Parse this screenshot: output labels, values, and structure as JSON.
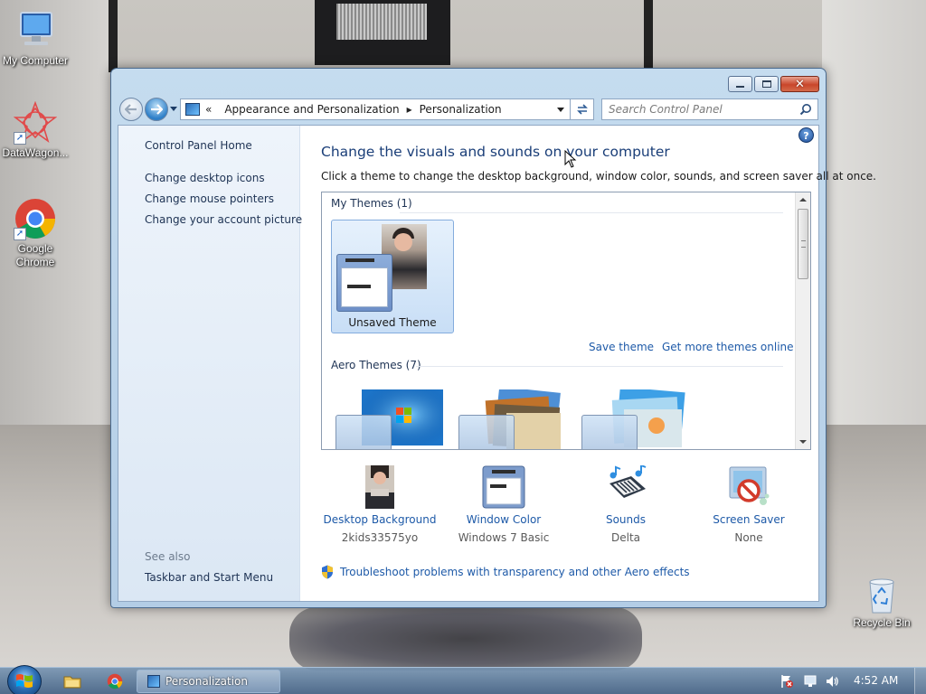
{
  "desktop": {
    "icons": [
      {
        "label": "My Computer"
      },
      {
        "label": "DataWagon..."
      },
      {
        "label": "Google Chrome"
      },
      {
        "label": "Recycle Bin"
      }
    ]
  },
  "window": {
    "title": "Personalization",
    "address": {
      "overflow": "«",
      "crumbs": [
        "Appearance and Personalization",
        "Personalization"
      ]
    },
    "search": {
      "placeholder": "Search Control Panel"
    },
    "left_pane": {
      "home": "Control Panel Home",
      "links": [
        "Change desktop icons",
        "Change mouse pointers",
        "Change your account picture"
      ],
      "see_also_label": "See also",
      "see_also_links": [
        "Taskbar and Start Menu"
      ]
    },
    "main": {
      "title": "Change the visuals and sounds on your computer",
      "description": "Click a theme to change the desktop background, window color, sounds, and screen saver all at once.",
      "my_themes_header": "My Themes (1)",
      "my_themes": [
        {
          "label": "Unsaved Theme"
        }
      ],
      "save_theme": "Save theme",
      "get_more": "Get more themes online",
      "aero_header": "Aero Themes (7)"
    },
    "bottom": [
      {
        "title": "Desktop Background",
        "sub": "2kids33575yo"
      },
      {
        "title": "Window Color",
        "sub": "Windows 7 Basic"
      },
      {
        "title": "Sounds",
        "sub": "Delta"
      },
      {
        "title": "Screen Saver",
        "sub": "None"
      }
    ],
    "troubleshoot": "Troubleshoot problems with transparency and other Aero effects"
  },
  "taskbar": {
    "task_label": "Personalization",
    "clock": "4:52 AM"
  },
  "colors": {
    "link": "#1e5aa8",
    "title_blue": "#1a3e78",
    "window_frame": "#c5dcef"
  }
}
